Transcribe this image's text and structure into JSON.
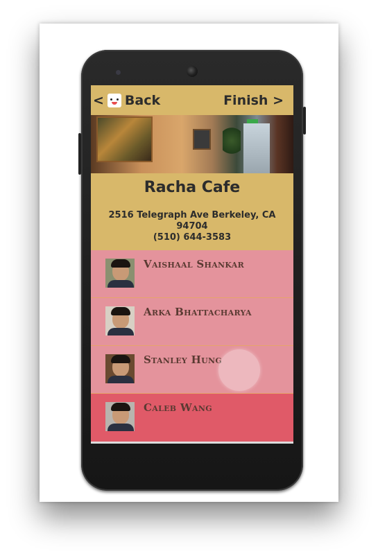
{
  "header": {
    "back_label": "Back",
    "back_chevron": "<",
    "finish_label": "Finish",
    "finish_chevron": ">"
  },
  "restaurant": {
    "name": "Racha Cafe",
    "address": "2516 Telegraph Ave Berkeley, CA 94704",
    "phone": "(510) 644-3583"
  },
  "people": [
    {
      "name": "Vaishaal Shankar",
      "selected": false
    },
    {
      "name": "Arka Bhattacharya",
      "selected": false
    },
    {
      "name": "Stanley Hung",
      "selected": false,
      "pressed": true
    },
    {
      "name": "Caleb Wang",
      "selected": true
    }
  ],
  "colors": {
    "header_bg": "#d8b86a",
    "row_bg": "#e4939c",
    "row_selected_bg": "#e05a68",
    "name_text": "#5a3a32"
  }
}
